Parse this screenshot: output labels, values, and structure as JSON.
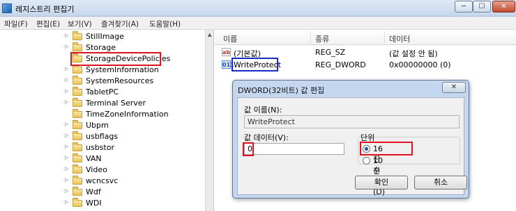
{
  "window": {
    "title": "레지스트리 편집기",
    "min_icon": "minimize-icon",
    "max_icon": "maximize-icon",
    "close_icon": "close-icon",
    "min_glyph": "─",
    "max_glyph": "☐",
    "close_glyph": "✕"
  },
  "menu": [
    "파일(F)",
    "편집(E)",
    "보기(V)",
    "즐겨찾기(A)",
    "도움말(H)"
  ],
  "tree": {
    "items": [
      "StillImage",
      "Storage",
      "StorageDevicePolicies",
      "SystemInformation",
      "SystemResources",
      "TabletPC",
      "Terminal Server",
      "TimeZoneInformation",
      "Ubpm",
      "usbflags",
      "usbstor",
      "VAN",
      "Video",
      "wcncsvc",
      "Wdf",
      "WDI"
    ],
    "arrow_glyph": "▷",
    "scroll_glyph": "▲"
  },
  "values_pane": {
    "columns": [
      "이름",
      "종류",
      "데이터"
    ],
    "rows": [
      {
        "icon": "ab",
        "name": "(기본값)",
        "type": "REG_SZ",
        "data": "(값 설정 안 됨)"
      },
      {
        "icon": "011",
        "name": "WriteProtect",
        "type": "REG_DWORD",
        "data": "0x00000000 (0)"
      }
    ]
  },
  "dialog": {
    "title": "DWORD(32비트) 값 편집",
    "close_glyph": "✕",
    "value_name_label": "값 이름(N):",
    "value_name": "WriteProtect",
    "value_data_label": "값 데이터(V):",
    "value_data": "0",
    "base_label": "단위",
    "hex_label": "16진수(H)",
    "dec_label": "10진수(D)",
    "selected_base": "16진수(H)",
    "ok_label": "확인",
    "cancel_label": "취소"
  },
  "highlight_colors": {
    "red": "#e0101c",
    "blue": "#1a2cc8"
  }
}
